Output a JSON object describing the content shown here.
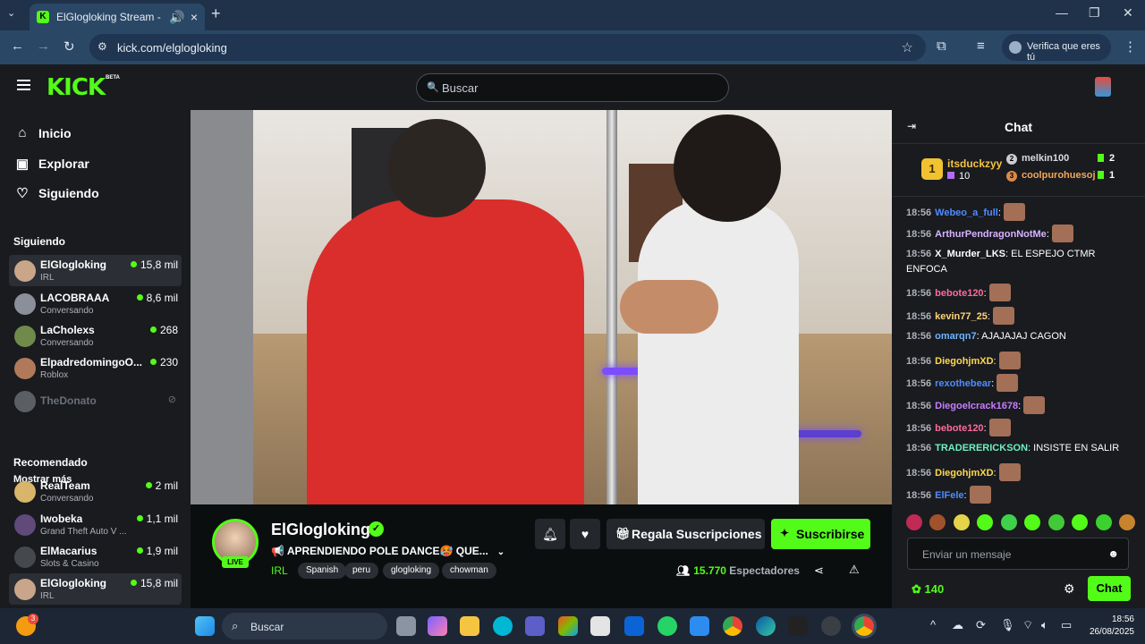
{
  "browser": {
    "tab_title": "ElGlogloking Stream - Watch",
    "url": "kick.com/elglogloking",
    "verify_label": "Verifica que eres tú"
  },
  "kick": {
    "logo": "KICK",
    "beta": "BETA",
    "search_placeholder": "Buscar",
    "brand_color": "#53fc18"
  },
  "sidebar": {
    "nav": [
      {
        "label": "Inicio",
        "icon": "home-icon"
      },
      {
        "label": "Explorar",
        "icon": "compass-icon"
      },
      {
        "label": "Siguiendo",
        "icon": "heart-icon"
      }
    ],
    "following_title": "Siguiendo",
    "following": [
      {
        "name": "ElGlogloking",
        "category": "IRL",
        "viewers": "15,8 mil"
      },
      {
        "name": "LACOBRAAA",
        "category": "Conversando",
        "viewers": "8,6 mil"
      },
      {
        "name": "LaCholexs",
        "category": "Conversando",
        "viewers": "268"
      },
      {
        "name": "ElpadredomingoO...",
        "category": "Roblox",
        "viewers": "230"
      },
      {
        "name": "TheDonato",
        "category": "",
        "viewers": ""
      }
    ],
    "show_more": "Mostrar más",
    "recommended_title": "Recomendado",
    "recommended": [
      {
        "name": "RealTeam",
        "category": "Conversando",
        "viewers": "2 mil"
      },
      {
        "name": "Iwobeka",
        "category": "Grand Theft Auto V ...",
        "viewers": "1,1 mil"
      },
      {
        "name": "ElMacarius",
        "category": "Slots & Casino",
        "viewers": "1,9 mil"
      },
      {
        "name": "ElGlogloking",
        "category": "IRL",
        "viewers": "15,8 mil"
      }
    ]
  },
  "stream": {
    "streamer": "ElGlogloking",
    "live_label": "LIVE",
    "title": "📢 APRENDIENDO POLE DANCE🥵 QUE...",
    "category": "IRL",
    "tags": [
      "Spanish",
      "peru",
      "glogloking",
      "chowman"
    ],
    "gift_label": "Regala Suscripciones",
    "subscribe_label": "Suscribirse",
    "viewers_count": "15.770",
    "viewers_label": "Espectadores"
  },
  "chat": {
    "title": "Chat",
    "leaderboard": {
      "first": {
        "rank": "1",
        "name": "itsduckzyy",
        "count": "10"
      },
      "second": {
        "rank": "2",
        "name": "melkin100",
        "count": "2"
      },
      "third": {
        "rank": "3",
        "name": "coolpurohuesoj",
        "count": "1"
      }
    },
    "messages": [
      {
        "time": "18:56",
        "user": "Webeo_a_full",
        "color": "#4e8cff",
        "text": "",
        "emote": true
      },
      {
        "time": "18:56",
        "user": "ArthurPendragonNotMe",
        "color": "#d9b3ff",
        "text": "",
        "emote": true
      },
      {
        "time": "18:56",
        "user": "X_Murder_LKS",
        "color": "#ffffff",
        "text": "EL ESPEJO CTMR ENFOCA",
        "emote": false
      },
      {
        "time": "18:56",
        "user": "bebote120",
        "color": "#ff6b9a",
        "text": "",
        "emote": true
      },
      {
        "time": "18:56",
        "user": "kevin77_25",
        "color": "#ffd27a",
        "text": "",
        "emote": true
      },
      {
        "time": "18:56",
        "user": "omarqn7",
        "color": "#6fb4ff",
        "text": "AJAJAJAJ CAGON",
        "emote": false
      },
      {
        "time": "18:56",
        "user": "DiegohjmXD",
        "color": "#ffd84d",
        "text": "",
        "emote": true
      },
      {
        "time": "18:56",
        "user": "rexothebear",
        "color": "#4e8cff",
        "text": "",
        "emote": true
      },
      {
        "time": "18:56",
        "user": "Diegoelcrack1678",
        "color": "#c77dff",
        "text": "",
        "emote": true
      },
      {
        "time": "18:56",
        "user": "bebote120",
        "color": "#ff6b9a",
        "text": "",
        "emote": true
      },
      {
        "time": "18:56",
        "user": "TRADERERICKSON",
        "color": "#6ff0c0",
        "text": "INSISTE EN SALIR",
        "emote": false
      },
      {
        "time": "18:56",
        "user": "DiegohjmXD",
        "color": "#ffd84d",
        "text": "",
        "emote": true
      },
      {
        "time": "18:56",
        "user": "ElFele",
        "color": "#4e8cff",
        "text": "",
        "emote": true
      }
    ],
    "input_placeholder": "Enviar un mensaje",
    "points": "140",
    "send_label": "Chat"
  },
  "taskbar": {
    "search_placeholder": "Buscar",
    "notification_badge": "3",
    "time": "18:56",
    "date": "26/08/2025"
  }
}
